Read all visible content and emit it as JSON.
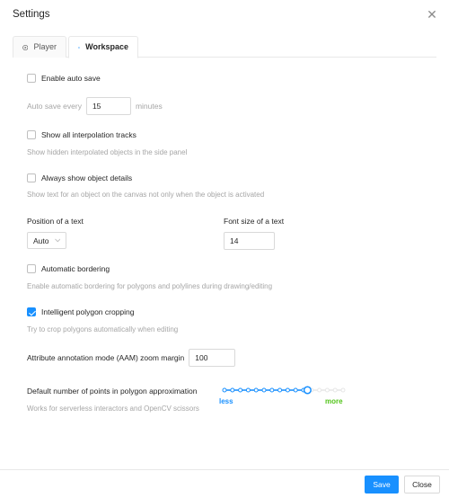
{
  "dialog": {
    "title": "Settings",
    "close_glyph": "✕"
  },
  "tabs": [
    {
      "label": "Player",
      "icon": "play-circle-icon",
      "active": false
    },
    {
      "label": "Workspace",
      "icon": "laptop-icon",
      "active": true
    }
  ],
  "workspace": {
    "auto_save": {
      "label": "Enable auto save",
      "checked": false
    },
    "auto_save_every": {
      "prefix": "Auto save every",
      "value": "15",
      "suffix": "minutes"
    },
    "interpolation": {
      "label": "Show all interpolation tracks",
      "checked": false,
      "hint": "Show hidden interpolated objects in the side panel"
    },
    "object_details": {
      "label": "Always show object details",
      "checked": false,
      "hint": "Show text for an object on the canvas not only when the object is activated"
    },
    "text_position": {
      "label": "Position of a text",
      "value": "Auto"
    },
    "font_size": {
      "label": "Font size of a text",
      "value": "14"
    },
    "auto_bordering": {
      "label": "Automatic bordering",
      "checked": false,
      "hint": "Enable automatic bordering for polygons and polylines during drawing/editing"
    },
    "polygon_cropping": {
      "label": "Intelligent polygon cropping",
      "checked": true,
      "hint": "Try to crop polygons automatically when editing"
    },
    "aam_zoom": {
      "label": "Attribute annotation mode (AAM) zoom margin",
      "value": "100"
    },
    "approximation": {
      "label": "Default number of points in polygon approximation",
      "hint": "Works for serverless interactors and OpenCV scissors",
      "less": "less",
      "more": "more",
      "level_fraction": 0.7
    }
  },
  "footer": {
    "save_label": "Save",
    "close_label": "Close"
  },
  "colors": {
    "accent": "#1890ff",
    "less_color": "#1890ff",
    "more_color": "#52c41a",
    "hint_text": "#a6a6a6"
  }
}
